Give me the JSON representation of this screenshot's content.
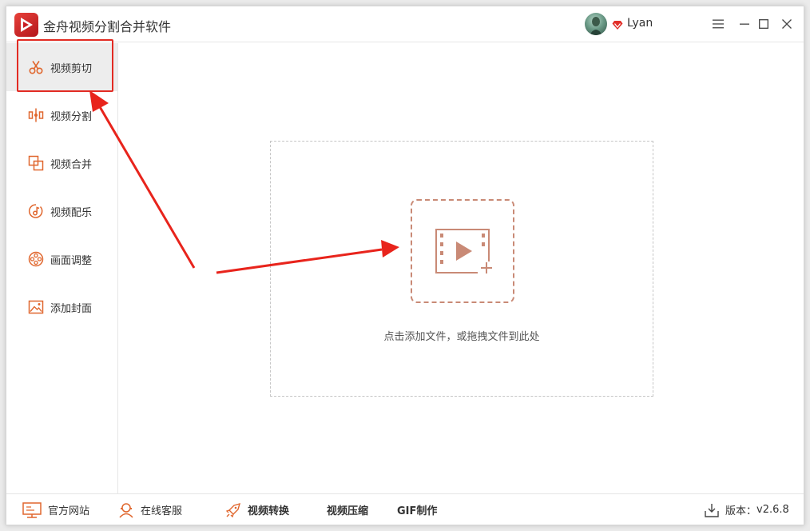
{
  "app": {
    "title": "金舟视频分割合并软件"
  },
  "user": {
    "name": "Lyan"
  },
  "sidebar": {
    "items": [
      {
        "label": "视频剪切",
        "icon": "scissors-icon",
        "active": true
      },
      {
        "label": "视频分割",
        "icon": "split-icon"
      },
      {
        "label": "视频合并",
        "icon": "merge-icon"
      },
      {
        "label": "视频配乐",
        "icon": "music-icon"
      },
      {
        "label": "画面调整",
        "icon": "film-reel-icon"
      },
      {
        "label": "添加封面",
        "icon": "image-icon"
      }
    ]
  },
  "main": {
    "drop_hint": "点击添加文件，或拖拽文件到此处",
    "add_icon": "add-video-icon"
  },
  "footer": {
    "official_site": "官方网站",
    "online_service": "在线客服",
    "video_convert": "视频转换",
    "video_compress": "视频压缩",
    "gif_make": "GIF制作",
    "version_label": "版本：",
    "version_value": "v2.6.8"
  },
  "colors": {
    "accent": "#e0672e",
    "highlight_red": "#e22b23",
    "add_box_border": "#c98a76",
    "active_bg": "#ededed"
  }
}
